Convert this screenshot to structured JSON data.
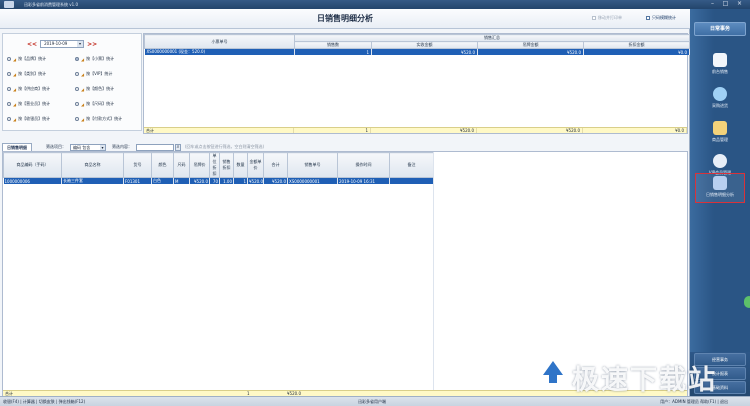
{
  "window": {
    "title": "迅彩多省前消费管理系统 v1.0"
  },
  "page": {
    "title": "日销售明细分析"
  },
  "top_links": {
    "print_preview": "移动并打印单",
    "export": "只码模糊统计"
  },
  "filters": {
    "date_value": "2019-10-09",
    "nav_prev": "<<",
    "nav_next": ">>",
    "options": [
      {
        "label": "按【品牌】统计",
        "selected": false
      },
      {
        "label": "按【小票】统计",
        "selected": true
      },
      {
        "label": "按【类别】统计",
        "selected": false
      },
      {
        "label": "按【VIP】统计",
        "selected": false
      },
      {
        "label": "按【供应商】统计",
        "selected": false
      },
      {
        "label": "按【颜色】统计",
        "selected": false
      },
      {
        "label": "按【营业员】统计",
        "selected": false
      },
      {
        "label": "按【尺码】统计",
        "selected": false
      },
      {
        "label": "按【收银员】统计",
        "selected": false
      },
      {
        "label": "按【付款方式】统计",
        "selected": false
      }
    ]
  },
  "summary": {
    "group_header_left": "小票单号",
    "group_header_right": "销售汇总",
    "columns": [
      "销售数",
      "实收金额",
      "吊牌金额",
      "折扣金额"
    ],
    "rows": [
      {
        "ticket": "XS0000000001 (现金：520.0)",
        "qty": "1",
        "actual": "¥520.0",
        "tag": "¥520.0",
        "discount": "¥0.0"
      }
    ],
    "total_label": "合计",
    "total": {
      "qty": "1",
      "actual": "¥520.0",
      "tag": "¥520.0",
      "discount": "¥0.0"
    }
  },
  "detail_toolbar": {
    "tab": "日销售明细",
    "filter_item_label": "筛选项目：",
    "filter_item_value": "编码 包含",
    "filter_content_label": "筛选内容：",
    "filter_content_value": "",
    "hint": "(回车或点击按钮进行筛选，空白则清空筛选)"
  },
  "detail": {
    "columns": [
      "商品编码（手码）",
      "商品名称",
      "货号",
      "颜色",
      "尺码",
      "吊牌价",
      "单位折扣",
      "销售折扣",
      "数量",
      "金额单价",
      "合计",
      "销售单号",
      "操作时间",
      "备注"
    ],
    "rows": [
      {
        "code": "1000000006",
        "name": "长袖三件套",
        "sku": "F01301",
        "color": "白色",
        "size": "M",
        "tag_price": "¥520.0",
        "unit_disc": "70",
        "sale_disc": "1.00",
        "qty": "1",
        "unit_price": "¥520.0",
        "total": "¥520.0",
        "order": "XS0000000001",
        "time": "2019-10-09 16:31",
        "note": ""
      }
    ],
    "total_label": "合计",
    "total_qty": "1",
    "total_amount": "¥520.0"
  },
  "sidebar": {
    "header": "日常事务",
    "items": [
      {
        "label": "前台销售",
        "active": false,
        "color": "#f2f6fb"
      },
      {
        "label": "采购进货",
        "active": false,
        "color": "#9fd0f5"
      },
      {
        "label": "商品管理",
        "active": false,
        "color": "#f3d27a"
      },
      {
        "label": "VIP会员管理",
        "active": false,
        "color": "#e7eef8"
      },
      {
        "label": "日销售明细分析",
        "active": true,
        "color": "#b7cff0"
      }
    ],
    "footer_items": [
      "经营事务",
      "统计报表",
      "基础资料"
    ]
  },
  "statusbar": {
    "left": "收银(F4) | 计算器 | 切换皮肤 | 弹出钱箱(F12)",
    "center": "迅彩多省用户端",
    "right": "用户：ADMIN 管理员   帮助(F1) | 退出"
  },
  "watermark": "极速下载站"
}
